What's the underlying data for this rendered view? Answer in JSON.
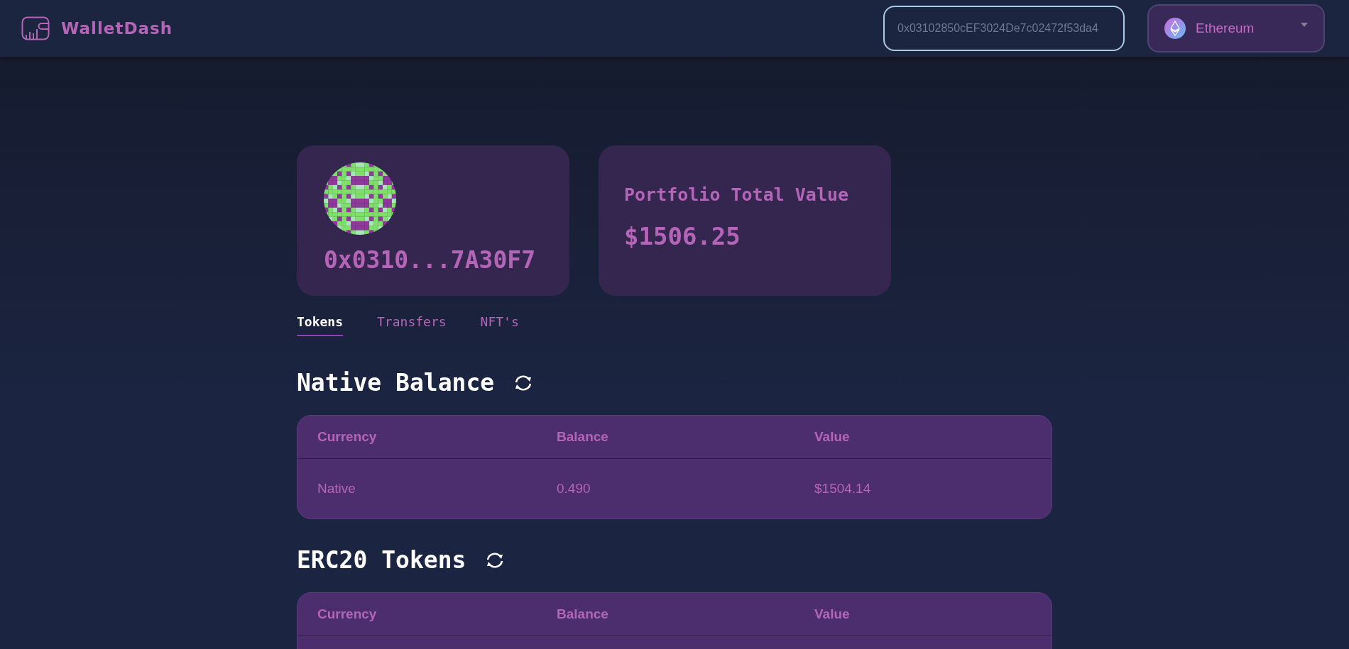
{
  "header": {
    "brand": "WalletDash",
    "address_input": {
      "value": "0x03102850cEF3024De7c02472f53da4"
    },
    "network": {
      "label": "Ethereum"
    }
  },
  "profile": {
    "address": "0x0310...7A30F7"
  },
  "portfolio": {
    "title": "Portfolio Total Value",
    "value": "$1506.25"
  },
  "tabs": [
    {
      "label": "Tokens",
      "selected": true
    },
    {
      "label": "Transfers",
      "selected": false
    },
    {
      "label": "NFT's",
      "selected": false
    }
  ],
  "sections": [
    {
      "title": "Native Balance",
      "table": {
        "columns": [
          "Currency",
          "Balance",
          "Value"
        ],
        "rows": [
          [
            "Native",
            "0.490",
            "$1504.14"
          ]
        ]
      }
    },
    {
      "title": "ERC20 Tokens",
      "table": {
        "columns": [
          "Currency",
          "Balance",
          "Value"
        ]
      }
    }
  ]
}
